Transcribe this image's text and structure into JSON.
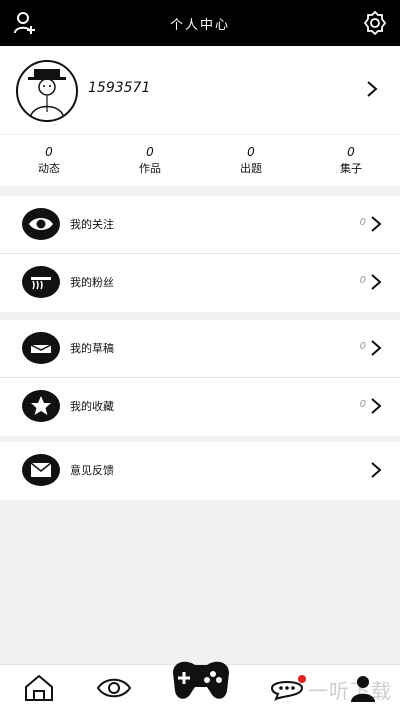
{
  "header": {
    "title": "个人中心"
  },
  "profile": {
    "username": "1593571"
  },
  "stats": [
    {
      "count": "0",
      "label": "动态"
    },
    {
      "count": "0",
      "label": "作品"
    },
    {
      "count": "0",
      "label": "出题"
    },
    {
      "count": "0",
      "label": "集子"
    }
  ],
  "menu": {
    "follows": {
      "label": "我的关注",
      "count": "0"
    },
    "fans": {
      "label": "我的粉丝",
      "count": "0"
    },
    "drafts": {
      "label": "我的草稿",
      "count": "0"
    },
    "favorites": {
      "label": "我的收藏",
      "count": "0"
    },
    "feedback": {
      "label": "意见反馈"
    }
  },
  "watermark": "一听下载",
  "icons": {
    "add_user": "add-user-icon",
    "settings": "gear-icon",
    "home": "home-icon",
    "discover": "eye-icon",
    "game": "gamepad-icon",
    "messages": "chat-icon",
    "profile": "user-icon"
  },
  "colors": {
    "header_bg": "#000000",
    "accent_red": "#e02020"
  }
}
